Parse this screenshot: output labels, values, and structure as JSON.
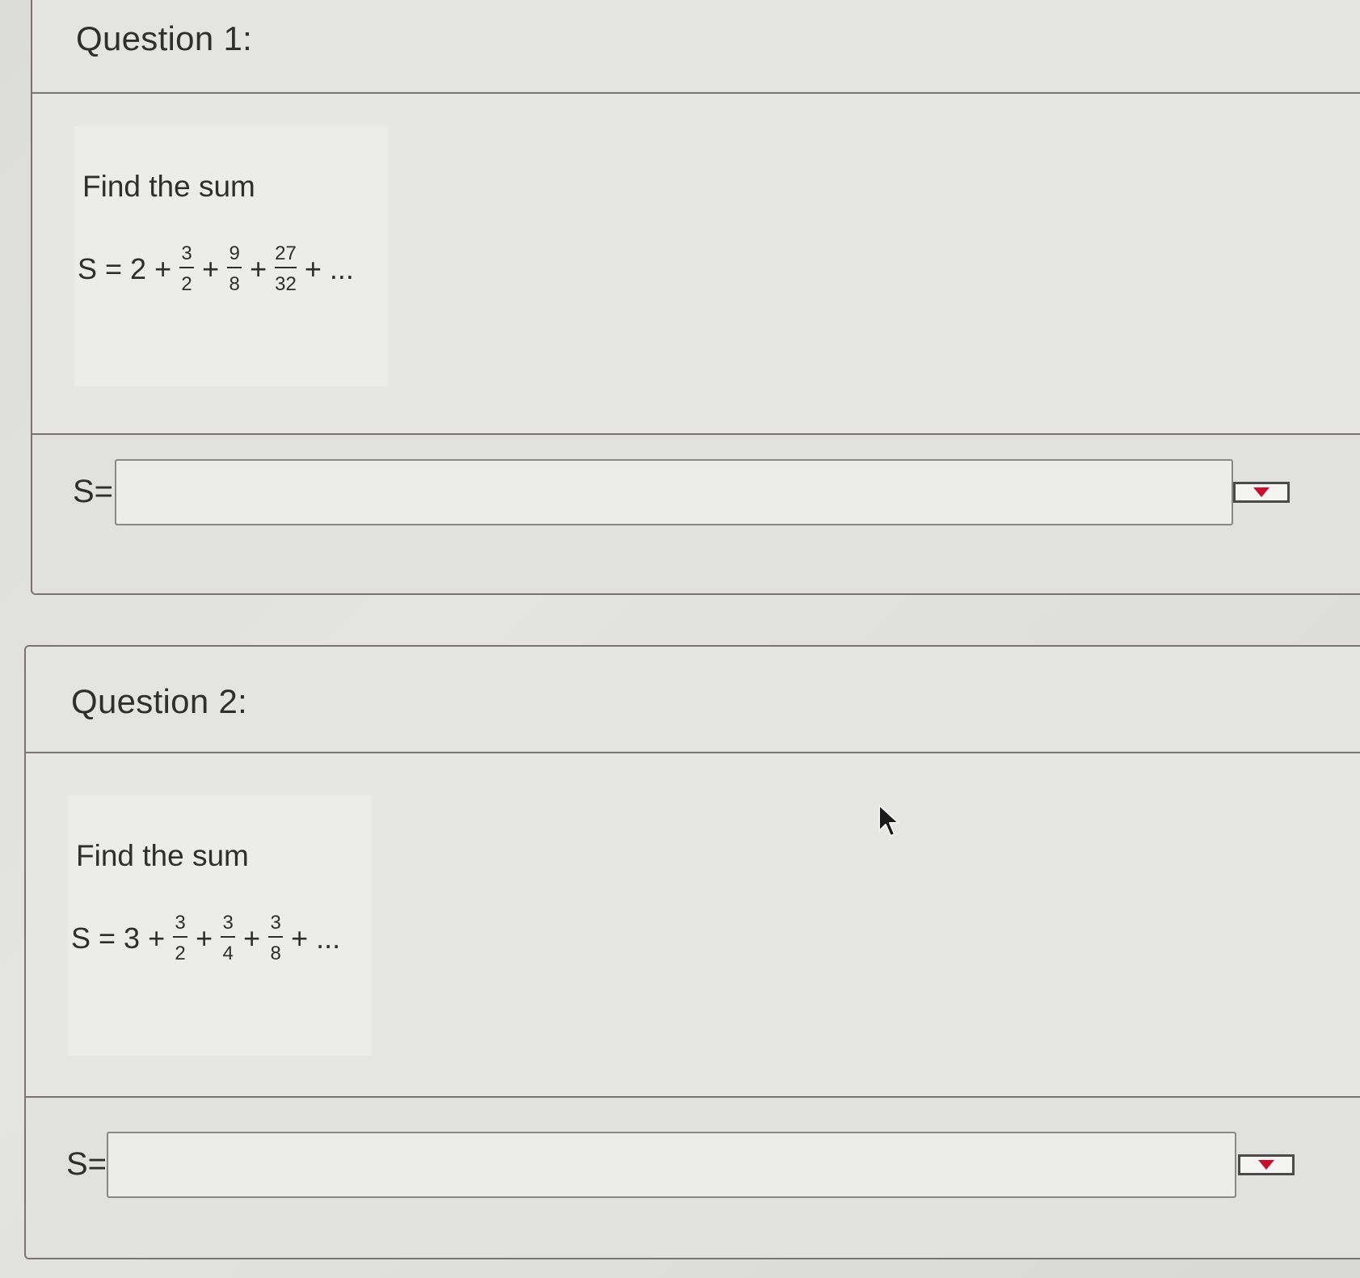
{
  "questions": [
    {
      "title": "Question 1:",
      "prompt": "Find the sum",
      "equation": {
        "lhs": "S = 2 +",
        "terms": [
          {
            "num": "3",
            "den": "2"
          },
          {
            "num": "9",
            "den": "8"
          },
          {
            "num": "27",
            "den": "32"
          }
        ],
        "plus": "+",
        "tail": "+ ..."
      },
      "answer_label": "S=",
      "answer_value": "",
      "dropdown_icon": "chevron-down-icon"
    },
    {
      "title": "Question 2:",
      "prompt": "Find the sum",
      "equation": {
        "lhs": "S = 3 +",
        "terms": [
          {
            "num": "3",
            "den": "2"
          },
          {
            "num": "3",
            "den": "4"
          },
          {
            "num": "3",
            "den": "8"
          }
        ],
        "plus": "+",
        "tail": "+ ..."
      },
      "answer_label": "S=",
      "answer_value": "",
      "dropdown_icon": "chevron-down-icon"
    }
  ],
  "colors": {
    "dropdown_arrow": "#c8102e",
    "border": "#7a7370"
  },
  "cursor_icon": "mouse-pointer-icon"
}
